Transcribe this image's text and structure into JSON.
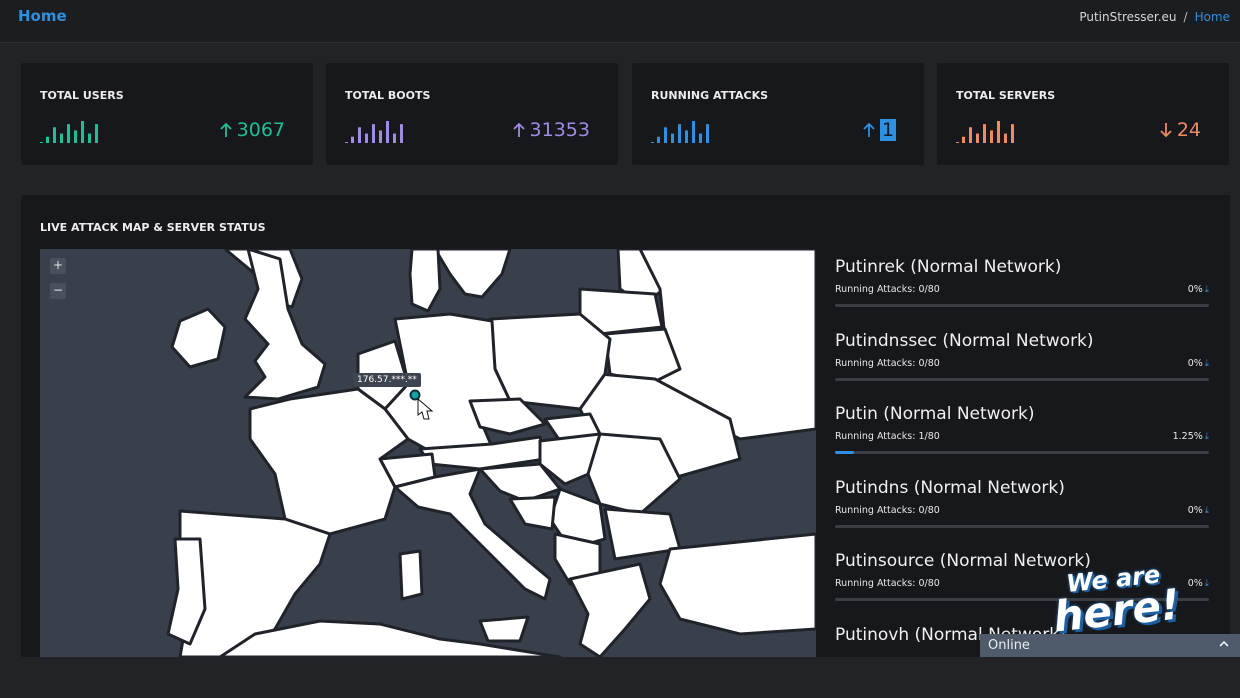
{
  "header": {
    "title": "Home",
    "breadcrumb": {
      "site": "PutinStresser.eu",
      "separator": "/",
      "current": "Home"
    }
  },
  "stats": [
    {
      "label": "TOTAL USERS",
      "value": "3067",
      "trend": "up",
      "color": "#1fbf95",
      "spark_values": [
        2,
        5,
        3,
        6,
        4,
        7,
        3,
        6
      ]
    },
    {
      "label": "TOTAL BOOTS",
      "value": "31353",
      "trend": "up",
      "color": "#a08be6",
      "spark_values": [
        2,
        5,
        3,
        6,
        4,
        7,
        3,
        6
      ]
    },
    {
      "label": "RUNNING ATTACKS",
      "value": "1",
      "trend": "up",
      "color": "#2f8fe0",
      "spark_values": [
        2,
        5,
        3,
        6,
        4,
        7,
        3,
        6
      ]
    },
    {
      "label": "TOTAL SERVERS",
      "value": "24",
      "trend": "down",
      "color": "#ee8a66",
      "spark_values": [
        2,
        5,
        3,
        6,
        4,
        7,
        3,
        6
      ]
    }
  ],
  "map_panel": {
    "title": "LIVE ATTACK MAP & SERVER STATUS",
    "zoom_in": "+",
    "zoom_out": "−",
    "marker_label": "176.57.***.**"
  },
  "servers": [
    {
      "name": "Putinrek (Normal Network)",
      "running": "Running Attacks: 0/80",
      "percent": "0%",
      "load": 0
    },
    {
      "name": "Putindnssec (Normal Network)",
      "running": "Running Attacks: 0/80",
      "percent": "0%",
      "load": 0
    },
    {
      "name": "Putin (Normal Network)",
      "running": "Running Attacks: 1/80",
      "percent": "1.25%",
      "load": 0.0125
    },
    {
      "name": "Putindns (Normal Network)",
      "running": "Running Attacks: 0/80",
      "percent": "0%",
      "load": 0
    },
    {
      "name": "Putinsource (Normal Network)",
      "running": "Running Attacks: 0/80",
      "percent": "0%",
      "load": 0
    },
    {
      "name": "Putinovh (Normal Network)",
      "running": "",
      "percent": "",
      "load": 0
    }
  ],
  "overlay": {
    "badge_line1": "We are",
    "badge_line2": "here!",
    "chat_status": "Online"
  },
  "colors": {
    "accent": "#2f8fe0",
    "background": "#222326",
    "card": "#17181b",
    "map_sea": "#3a404b",
    "map_land": "#ffffff"
  }
}
